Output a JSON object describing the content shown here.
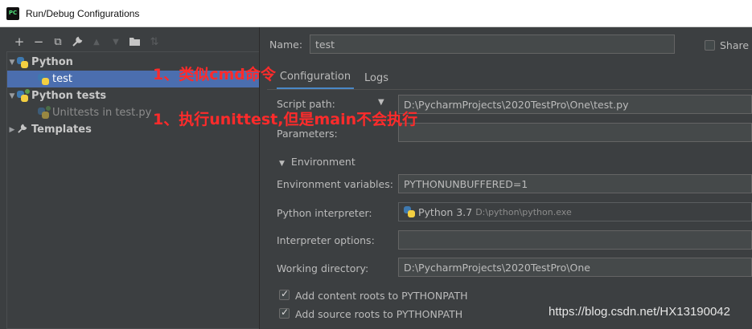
{
  "window": {
    "title": "Run/Debug Configurations",
    "app_icon": "PC"
  },
  "toolbar": {
    "buttons": [
      {
        "icon": "plus-icon",
        "glyph": "+"
      },
      {
        "icon": "minus-icon",
        "glyph": "−"
      },
      {
        "icon": "copy-icon",
        "glyph": "⧉"
      },
      {
        "icon": "wrench-icon",
        "glyph": "🔧"
      },
      {
        "icon": "arrow-up-icon",
        "glyph": "▲"
      },
      {
        "icon": "arrow-down-icon",
        "glyph": "▼"
      },
      {
        "icon": "folder-icon",
        "glyph": "▆"
      },
      {
        "icon": "sort-icon",
        "glyph": "⇅"
      }
    ]
  },
  "tree": {
    "python": "Python",
    "test": "test",
    "python_tests": "Python tests",
    "unittests": "Unittests in test.py",
    "templates": "Templates"
  },
  "form": {
    "name_label": "Name:",
    "name_value": "test",
    "share_label": "Share",
    "tabs": [
      "Configuration",
      "Logs"
    ],
    "script_path_label": "Script path:",
    "script_path_value": "D:\\PycharmProjects\\2020TestPro\\One\\test.py",
    "parameters_label": "Parameters:",
    "environment_section": "Environment",
    "env_vars_label": "Environment variables:",
    "env_vars_value": "PYTHONUNBUFFERED=1",
    "interpreter_label": "Python interpreter:",
    "interpreter_name": "Python 3.7",
    "interpreter_path": "D:\\python\\python.exe",
    "interp_options_label": "Interpreter options:",
    "working_dir_label": "Working directory:",
    "working_dir_value": "D:\\PycharmProjects\\2020TestPro\\One",
    "add_content_roots": "Add content roots to PYTHONPATH",
    "add_source_roots": "Add source roots to PYTHONPATH"
  },
  "annotations": {
    "note1": "1、类似cmd命令",
    "note2": "1、执行unittest,但是main不会执行"
  },
  "watermark": "https://blog.csdn.net/HX13190042"
}
